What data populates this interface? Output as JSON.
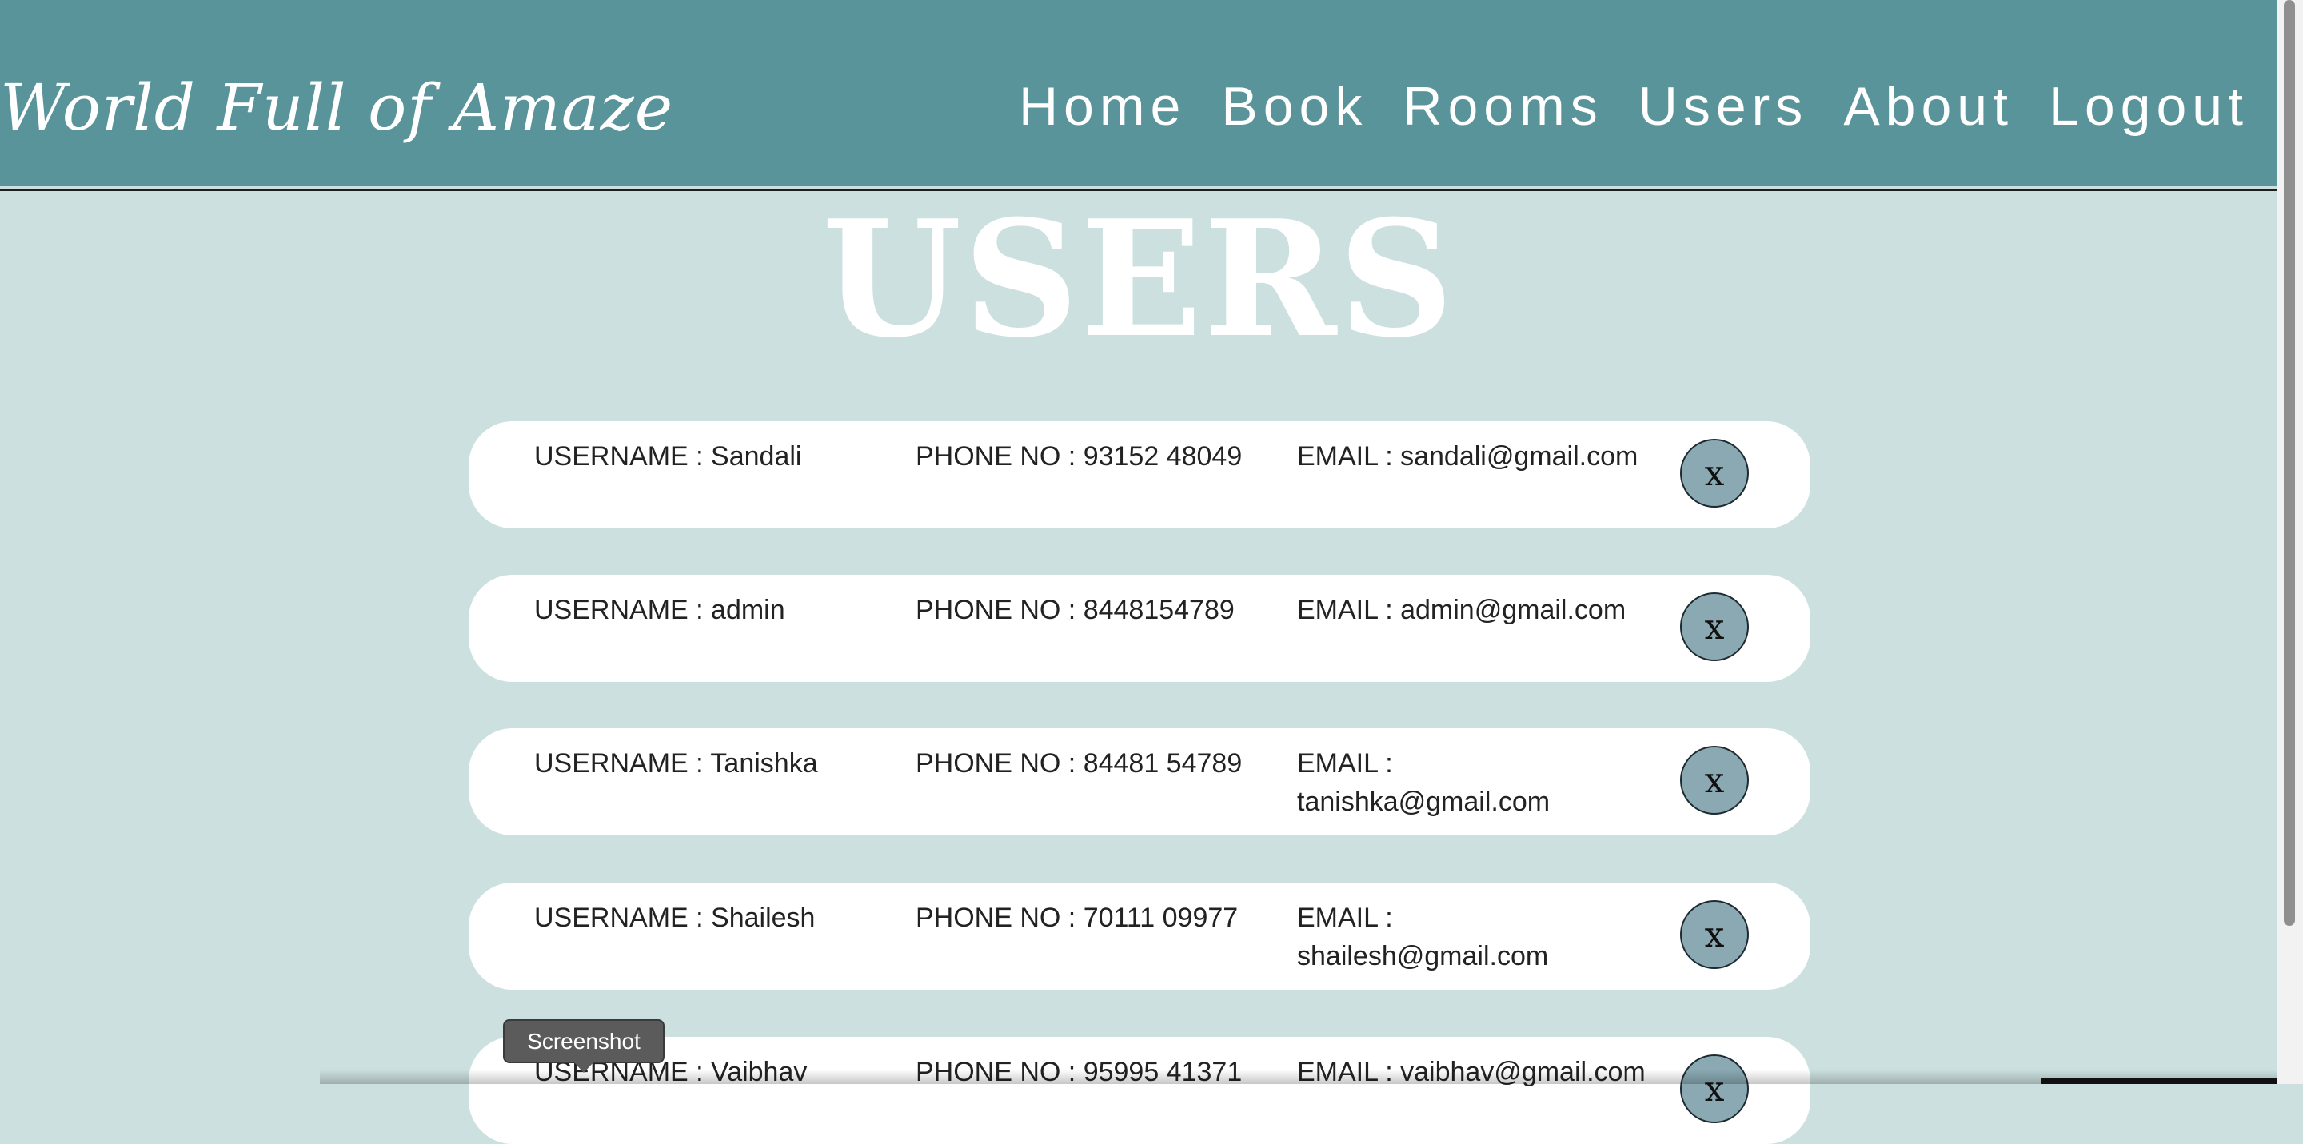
{
  "header": {
    "logo": "World Full of Amaze",
    "nav": [
      "Home",
      "Book",
      "Rooms",
      "Users",
      "About",
      "Logout"
    ]
  },
  "page": {
    "title": "USERS"
  },
  "users": [
    {
      "username": "USERNAME : Sandali",
      "phone": "PHONE NO : 93152 48049",
      "email": "EMAIL : sandali@gmail.com",
      "delete_label": "x"
    },
    {
      "username": "USERNAME : admin",
      "phone": "PHONE NO : 8448154789",
      "email": "EMAIL : admin@gmail.com",
      "delete_label": "x"
    },
    {
      "username": "USERNAME : Tanishka",
      "phone": "PHONE NO : 84481 54789",
      "email": "EMAIL : tanishka@gmail.com",
      "delete_label": "x"
    },
    {
      "username": "USERNAME : Shailesh",
      "phone": "PHONE NO : 70111 09977",
      "email": "EMAIL : shailesh@gmail.com",
      "delete_label": "x"
    },
    {
      "username": "USERNAME : Vaibhav",
      "phone": "PHONE NO : 95995 41371",
      "email": "EMAIL : vaibhav@gmail.com",
      "delete_label": "x"
    }
  ],
  "tooltip": {
    "text": "Screenshot"
  },
  "colors": {
    "header_bg": "#5a949b",
    "page_bg": "#cbe0df",
    "card_bg": "#ffffff",
    "delete_button_bg": "#8aa9b3"
  }
}
